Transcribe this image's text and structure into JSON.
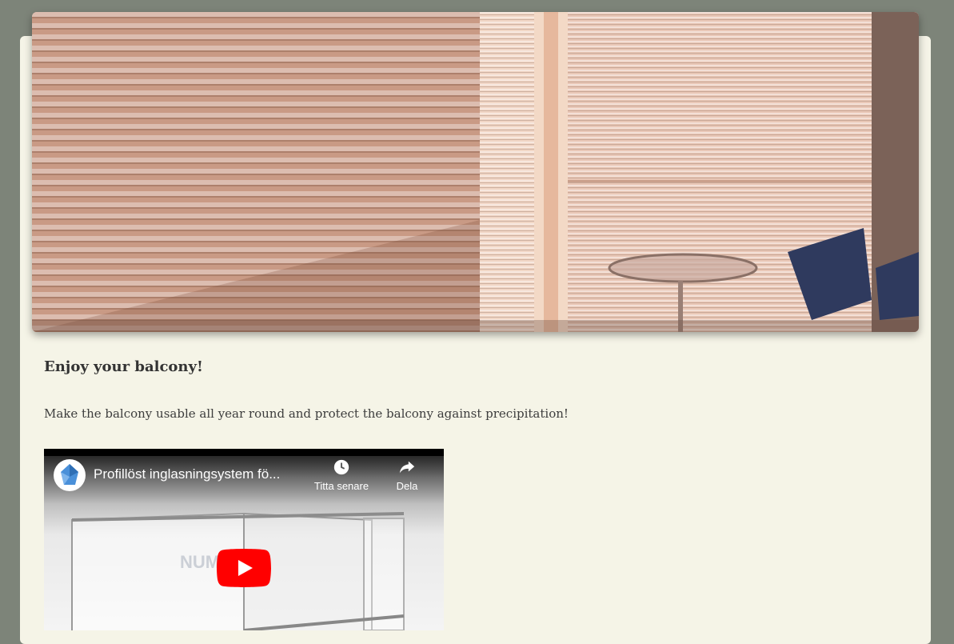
{
  "article": {
    "heading": "Enjoy your balcony!",
    "paragraph": "Make the balcony usable all year round and protect the balcony against precipitation!"
  },
  "video": {
    "title": "Profillöst inglasningsystem fö...",
    "watch_later_label": "Titta senare",
    "share_label": "Dela",
    "brand_fragment": "NUM",
    "play_color": "#ff0000"
  },
  "colors": {
    "page_background": "#7d8479",
    "card_background": "#f5f4e7"
  }
}
